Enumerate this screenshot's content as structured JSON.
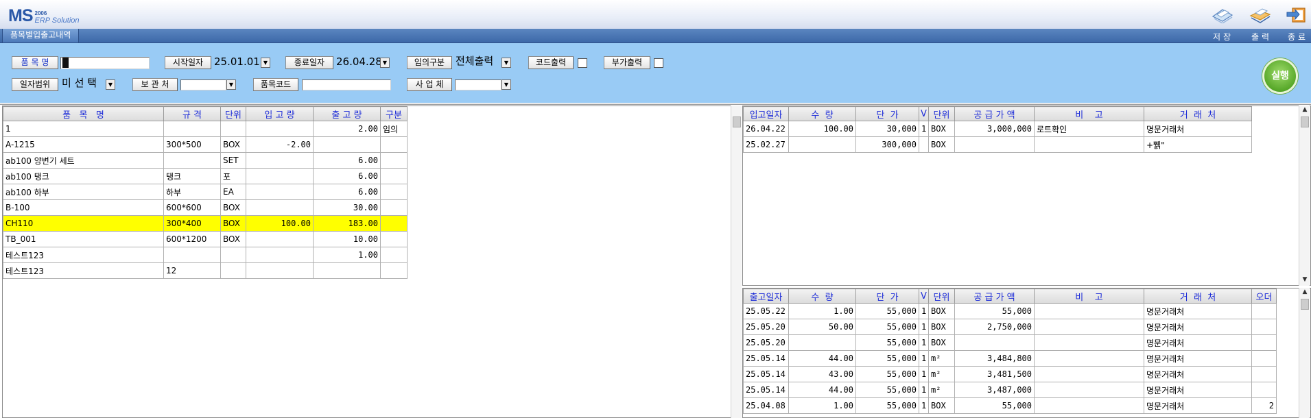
{
  "app": {
    "logo_main": "MS",
    "logo_year": "2006",
    "logo_sub": "ERP Solution",
    "window_title": "품목별입출고내역"
  },
  "menu": {
    "save": "저장",
    "print": "출력",
    "exit": "종료"
  },
  "filters": {
    "item_name_label": "품 목 명",
    "item_name_value": "1",
    "start_date_label": "시작일자",
    "start_date_value": "25.01.01",
    "end_date_label": "종료일자",
    "end_date_value": "26.04.28",
    "category_label": "임의구분",
    "category_value": "전체출력",
    "code_print_label": "코드출력",
    "extra_print_label": "부가출력",
    "date_range_label": "일자범위",
    "date_range_value": "미 선 택",
    "storage_label": "보 관 처",
    "storage_value": "",
    "item_code_label": "품목코드",
    "item_code_value": "",
    "business_label": "사 업 체",
    "business_value": "",
    "run_label": "실행"
  },
  "item_grid": {
    "headers": [
      "품   목   명",
      "규 격",
      "단위",
      "입 고 량",
      "출 고 량",
      "구분"
    ],
    "rows": [
      [
        "1",
        "",
        "",
        "",
        "2.00",
        "임의"
      ],
      [
        "A-1215",
        "300*500",
        "BOX",
        "-2.00",
        "",
        ""
      ],
      [
        "ab100 양변기 세트",
        "",
        "SET",
        "",
        "6.00",
        ""
      ],
      [
        "ab100 탱크",
        "탱크",
        "포",
        "",
        "6.00",
        ""
      ],
      [
        "ab100 하부",
        "하부",
        "EA",
        "",
        "6.00",
        ""
      ],
      [
        "B-100",
        "600*600",
        "BOX",
        "",
        "30.00",
        ""
      ],
      [
        "CH110",
        "300*400",
        "BOX",
        "100.00",
        "183.00",
        ""
      ],
      [
        "TB_001",
        "600*1200",
        "BOX",
        "",
        "10.00",
        ""
      ],
      [
        "테스트123",
        "",
        "",
        "",
        "1.00",
        ""
      ],
      [
        "테스트123",
        "12",
        "",
        "",
        "",
        ""
      ]
    ],
    "highlight_row": 6
  },
  "in_grid": {
    "headers": [
      "입고일자",
      "수  량",
      "단  가",
      "V",
      "단위",
      "공 급 가 액",
      "비    고",
      "거  래  처"
    ],
    "rows": [
      [
        "26.04.22",
        "100.00",
        "30,000",
        "1",
        "BOX",
        "3,000,000",
        "로트확인",
        "명문거래처"
      ],
      [
        "25.02.27",
        "",
        "300,000",
        "",
        "BOX",
        "",
        "",
        "+쀍\""
      ]
    ]
  },
  "out_grid": {
    "headers": [
      "출고일자",
      "수  량",
      "단  가",
      "V",
      "단위",
      "공 급 가 액",
      "비    고",
      "거  래  처",
      "오더"
    ],
    "rows": [
      [
        "25.05.22",
        "1.00",
        "55,000",
        "1",
        "BOX",
        "55,000",
        "",
        "명문거래처",
        ""
      ],
      [
        "25.05.20",
        "50.00",
        "55,000",
        "1",
        "BOX",
        "2,750,000",
        "",
        "명문거래처",
        ""
      ],
      [
        "25.05.20",
        "",
        "55,000",
        "1",
        "BOX",
        "",
        "",
        "명문거래처",
        ""
      ],
      [
        "25.05.14",
        "44.00",
        "55,000",
        "1",
        "m²",
        "3,484,800",
        "",
        "명문거래처",
        ""
      ],
      [
        "25.05.14",
        "43.00",
        "55,000",
        "1",
        "m²",
        "3,481,500",
        "",
        "명문거래처",
        ""
      ],
      [
        "25.05.14",
        "44.00",
        "55,000",
        "1",
        "m²",
        "3,487,000",
        "",
        "명문거래처",
        ""
      ],
      [
        "25.04.08",
        "1.00",
        "55,000",
        "1",
        "BOX",
        "55,000",
        "",
        "명문거래처",
        "2"
      ]
    ]
  },
  "icons": {
    "toolbar": [
      "save-icon",
      "print-icon",
      "exit-icon"
    ],
    "dropdown": "chevron-down-icon"
  },
  "colors": {
    "filter_bg": "#99cbf5",
    "menubar": "#3c68a8",
    "highlight": "#ffff00",
    "header_text": "#1e2dd8",
    "run_button": "#58a82a"
  }
}
